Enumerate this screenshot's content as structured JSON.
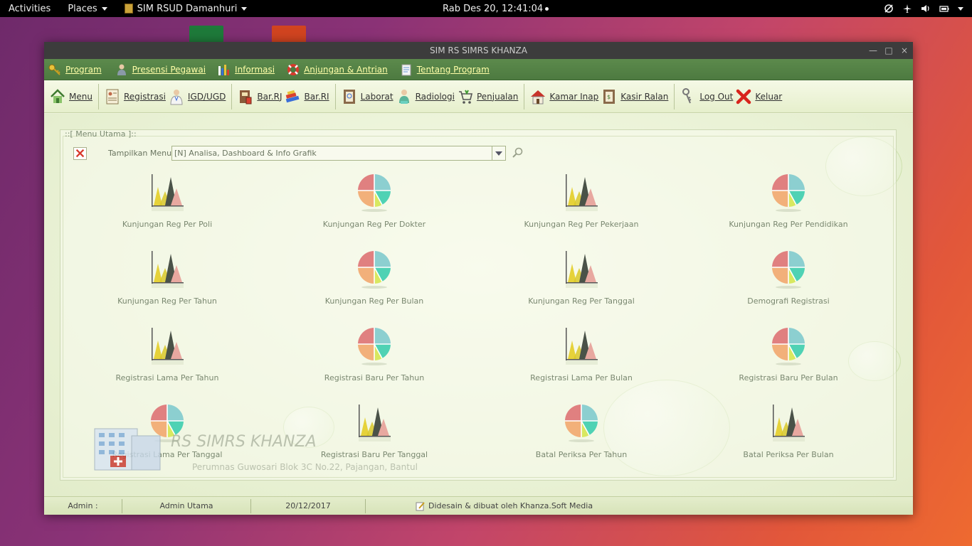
{
  "topbar": {
    "activities": "Activities",
    "places": "Places",
    "app_name": "SIM RSUD Damanhuri",
    "clock": "Rab Des 20, 12:41:04"
  },
  "window": {
    "title": "SIM RS SIMRS KHANZA",
    "controls": {
      "minimize": "—",
      "maximize": "□",
      "close": "×"
    }
  },
  "menubar": {
    "items": [
      {
        "label": "Program",
        "icon": "key-icon"
      },
      {
        "label": "Presensi Pegawai",
        "icon": "person-icon"
      },
      {
        "label": "Informasi",
        "icon": "bar-chart-icon"
      },
      {
        "label": "Anjungan & Antrian",
        "icon": "lifebuoy-icon"
      },
      {
        "label": "Tentang Program",
        "icon": "document-icon"
      }
    ]
  },
  "toolbar": {
    "items": [
      {
        "label": "Menu"
      },
      {
        "label": "Registrasi"
      },
      {
        "label": "IGD/UGD"
      },
      {
        "label": "Bar.RJ"
      },
      {
        "label": "Bar.RI"
      },
      {
        "label": "Laborat"
      },
      {
        "label": "Radiologi"
      },
      {
        "label": "Penjualan"
      },
      {
        "label": "Kamar Inap"
      },
      {
        "label": "Kasir Ralan"
      },
      {
        "label": "Log Out"
      },
      {
        "label": "Keluar"
      }
    ]
  },
  "main_menu": {
    "panel_title": "::[ Menu Utama ]::",
    "filter_label": "Tampilkan Menu :",
    "filter_value": "[N] Analisa, Dashboard & Info Grafik",
    "items": [
      {
        "label": "Kunjungan Reg Per Poli",
        "icon": "area-chart-icon"
      },
      {
        "label": "Kunjungan Reg Per Dokter",
        "icon": "pie-chart-icon"
      },
      {
        "label": "Kunjungan Reg Per Pekerjaan",
        "icon": "area-chart-icon"
      },
      {
        "label": "Kunjungan Reg Per Pendidikan",
        "icon": "pie-chart-icon"
      },
      {
        "label": "Kunjungan Reg Per Tahun",
        "icon": "area-chart-icon"
      },
      {
        "label": "Kunjungan Reg Per Bulan",
        "icon": "pie-chart-icon"
      },
      {
        "label": "Kunjungan Reg Per Tanggal",
        "icon": "area-chart-icon"
      },
      {
        "label": "Demografi Registrasi",
        "icon": "pie-chart-icon"
      },
      {
        "label": "Registrasi Lama Per Tahun",
        "icon": "area-chart-icon"
      },
      {
        "label": "Registrasi Baru Per Tahun",
        "icon": "pie-chart-icon"
      },
      {
        "label": "Registrasi Lama Per Bulan",
        "icon": "area-chart-icon"
      },
      {
        "label": "Registrasi Baru Per Bulan",
        "icon": "pie-chart-icon"
      },
      {
        "label": "Registrasi Lama Per Tanggal",
        "icon": "pie-chart-icon"
      },
      {
        "label": "Registrasi Baru Per Tanggal",
        "icon": "area-chart-icon"
      },
      {
        "label": "Batal Periksa Per Tahun",
        "icon": "pie-chart-icon"
      },
      {
        "label": "Batal Periksa Per Bulan",
        "icon": "area-chart-icon"
      }
    ]
  },
  "watermark": {
    "title": "RS SIMRS KHANZA",
    "address": "Perumnas Guwosari Blok 3C No.22, Pajangan, Bantul"
  },
  "statusbar": {
    "user_label": "Admin :",
    "user_value": "Admin Utama",
    "date": "20/12/2017",
    "credit": "Didesain & dibuat oleh Khanza.Soft Media"
  },
  "colors": {
    "menubar_bg": "#4d7a40",
    "menubar_text": "#ffffa8",
    "content_bg": "#eaf2d6"
  }
}
